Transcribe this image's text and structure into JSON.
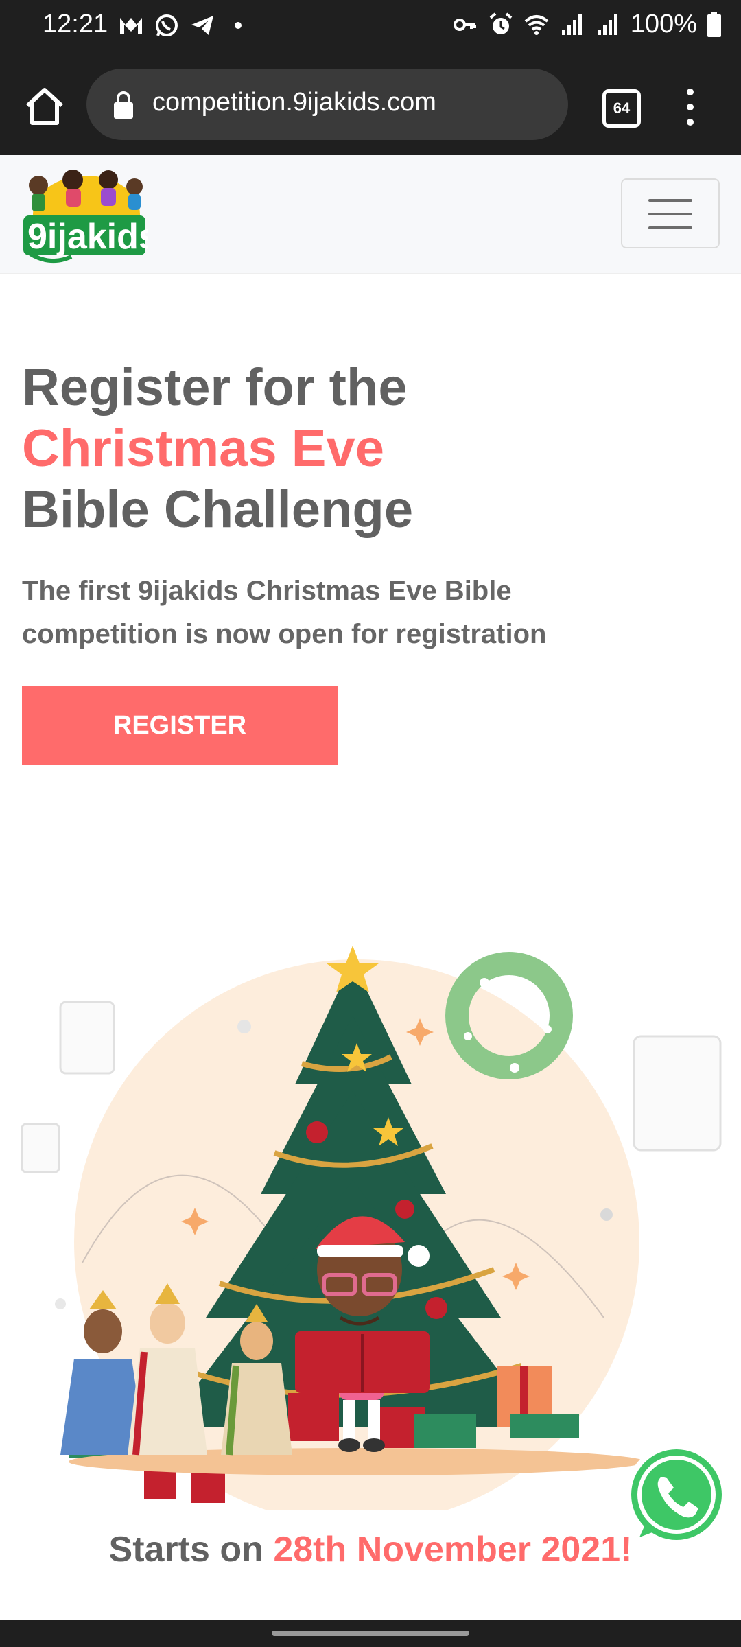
{
  "status_bar": {
    "time": "12:21",
    "left_icons": [
      "gmail-icon",
      "whatsapp-icon",
      "telegram-icon",
      "dot-icon"
    ],
    "right_icons": [
      "vpn-key-icon",
      "alarm-icon",
      "wifi-icon",
      "signal-icon",
      "signal-icon"
    ],
    "battery": "100%"
  },
  "browser": {
    "url": "competition.9ijakids.com",
    "tab_count": "64"
  },
  "header": {
    "logo_text": "9ijakids"
  },
  "hero": {
    "title_line1": "Register for the",
    "title_line2": "Christmas Eve",
    "title_line3": "Bible Challenge",
    "subtitle_line1": "The first 9ijakids Christmas Eve Bible",
    "subtitle_line2": "competition is now open for registration",
    "register_label": "REGISTER"
  },
  "footer_text": {
    "starts_on": "Starts on",
    "date": "28th November 2021!"
  },
  "colors": {
    "accent": "#ff6b6b",
    "text": "#616161",
    "whatsapp": "#3ec766"
  }
}
